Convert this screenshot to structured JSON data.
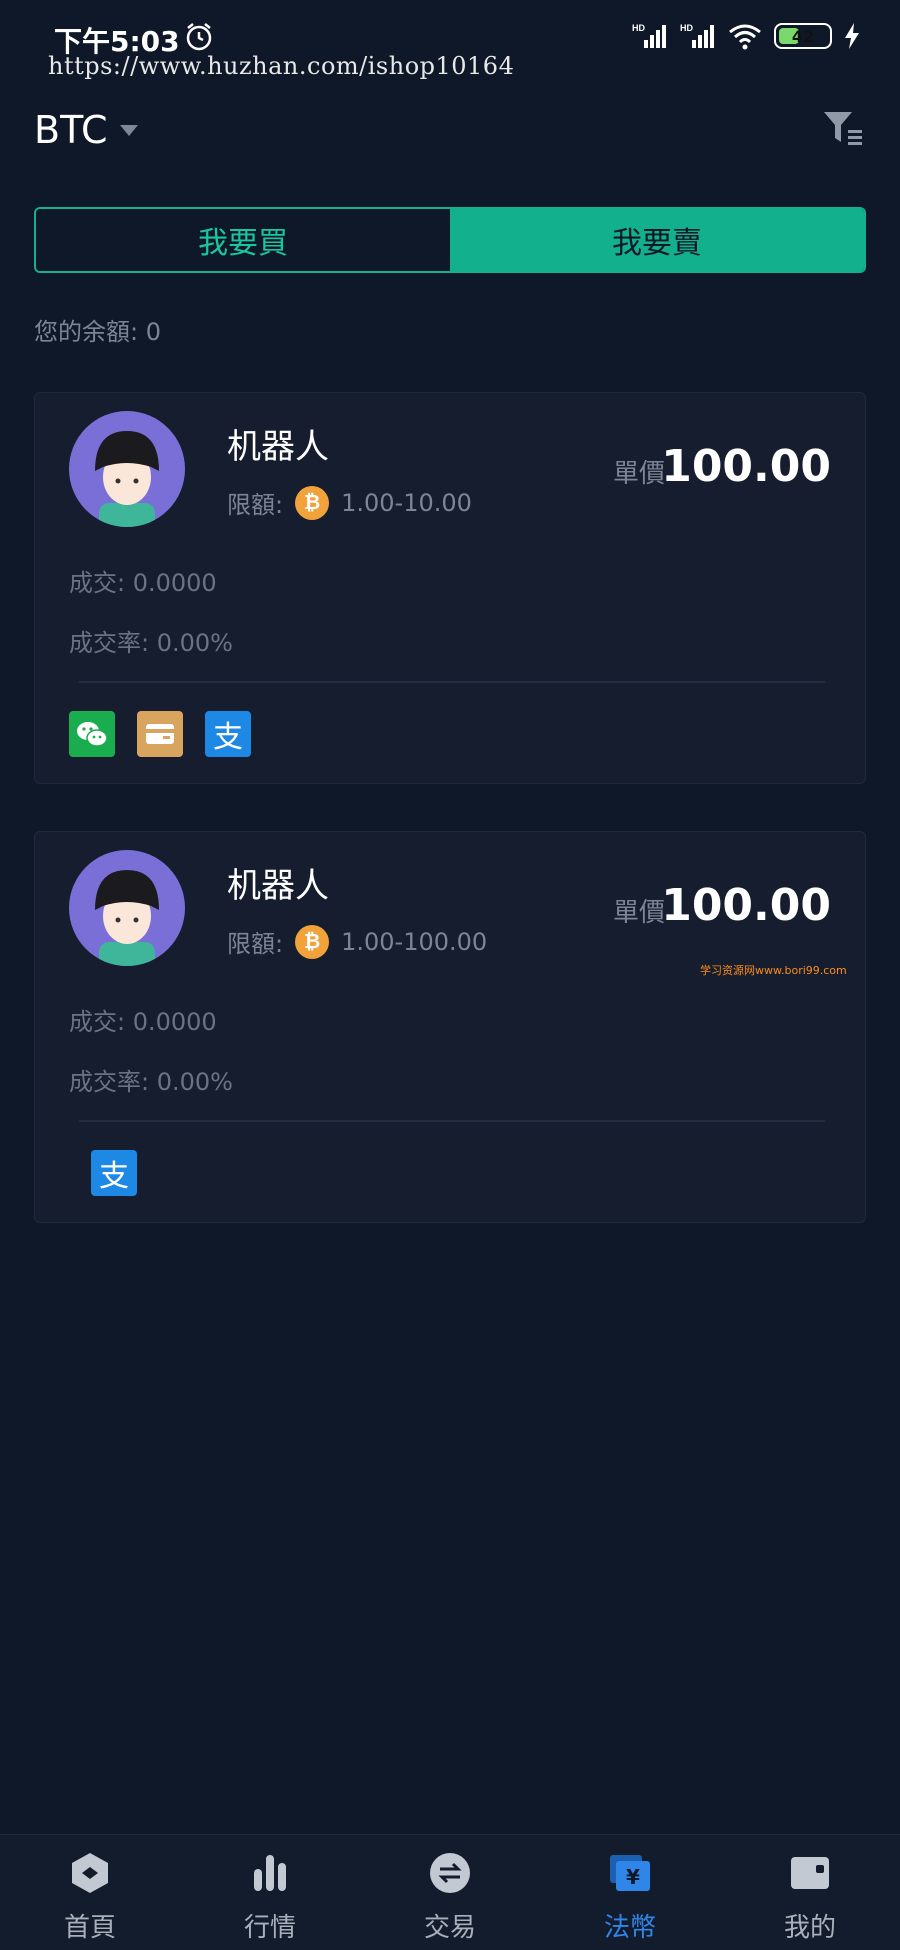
{
  "status_bar": {
    "time": "下午5:03",
    "url_overlay": "https://www.huzhan.com/ishop10164",
    "battery": "42",
    "battery_fraction": 0.42
  },
  "header": {
    "coin": "BTC",
    "coin_caret_icon": "caret-down-icon",
    "filter_icon": "filter-list-icon"
  },
  "tabs": [
    {
      "label": "我要買",
      "active": false
    },
    {
      "label": "我要賣",
      "active": true
    }
  ],
  "balance": {
    "text": "您的余額: 0"
  },
  "listings": [
    {
      "name": "机器人",
      "limit_label": "限額:",
      "limit_range": "1.00-10.00",
      "price_label": "單價",
      "price": "100.00",
      "volume": "成交: 0.0000",
      "rate": "成交率: 0.00%",
      "payment_methods": [
        "wechat-pay-icon",
        "bank-card-icon",
        "alipay-icon"
      ]
    },
    {
      "name": "机器人",
      "limit_label": "限額:",
      "limit_range": "1.00-100.00",
      "price_label": "單價",
      "price": "100.00",
      "volume": "成交: 0.0000",
      "rate": "成交率: 0.00%",
      "payment_methods": [
        "alipay-icon"
      ]
    }
  ],
  "watermark": "学习资源网www.bori99.com",
  "colors": {
    "background": "#0e1828",
    "accent": "#13b08e",
    "card": "#151d2f",
    "nav_active": "#2f86e8"
  },
  "bottom_nav": [
    {
      "label": "首頁",
      "icon": "home-icon",
      "active": false
    },
    {
      "label": "行情",
      "icon": "market-bars-icon",
      "active": false
    },
    {
      "label": "交易",
      "icon": "exchange-icon",
      "active": false
    },
    {
      "label": "法幣",
      "icon": "fiat-currency-icon",
      "active": true
    },
    {
      "label": "我的",
      "icon": "wallet-icon",
      "active": false
    }
  ]
}
